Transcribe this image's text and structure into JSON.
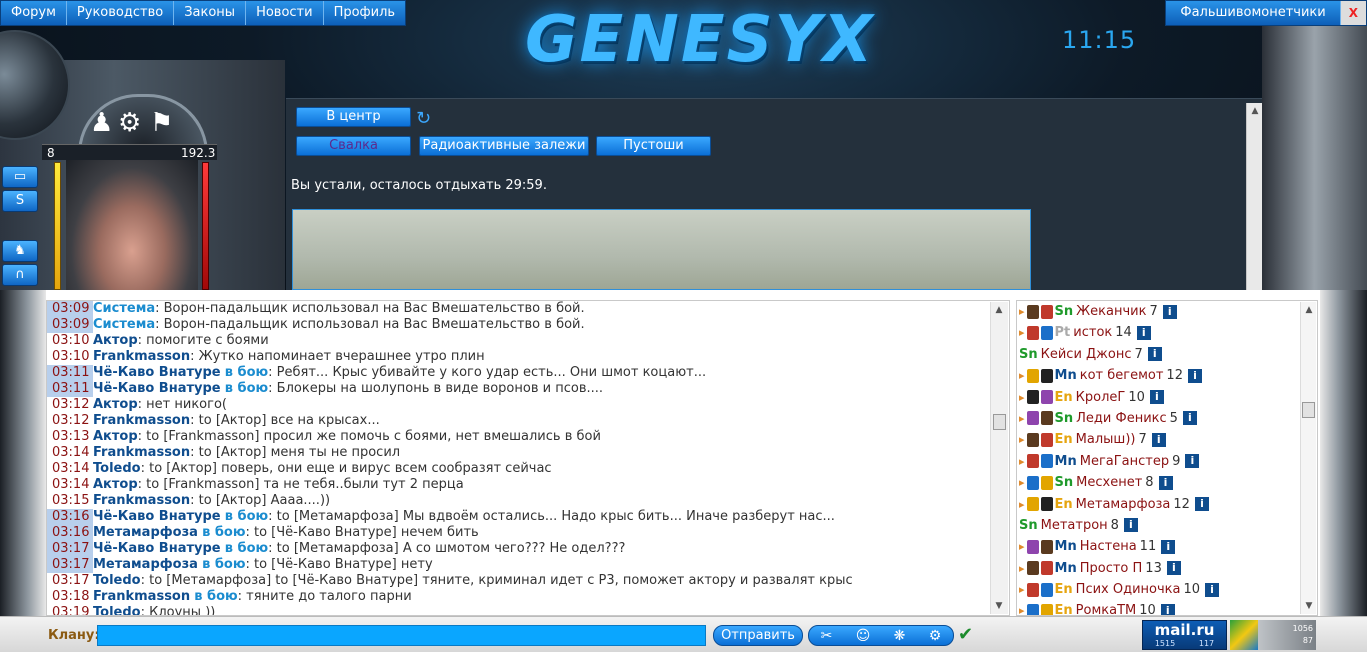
{
  "nav": {
    "items": [
      "Форум",
      "Руководство",
      "Законы",
      "Новости",
      "Профиль"
    ],
    "right_item": "Фальшивомонетчики",
    "close": "X"
  },
  "logo_text": "GENESYX",
  "clock": "11:15",
  "hud": {
    "hp_left": "8",
    "hp_right": "192.3"
  },
  "location": {
    "center_btn": "В центр",
    "exits": [
      "Свалка",
      "Радиоактивные залежи",
      "Пустоши"
    ],
    "rest_message": "Вы устали, осталось отдыхать 29:59."
  },
  "chat": {
    "lines": [
      {
        "time": "03:09",
        "hl": true,
        "nick": "Система",
        "sys": true,
        "battle": "",
        "text": ": Ворон-падальщик использовал на Вас Вмешательство в бой."
      },
      {
        "time": "03:09",
        "hl": true,
        "nick": "Система",
        "sys": true,
        "battle": "",
        "text": ": Ворон-падальщик использовал на Вас Вмешательство в бой."
      },
      {
        "time": "03:10",
        "hl": false,
        "nick": "Актор",
        "sys": false,
        "battle": "",
        "text": ": помогите с боями"
      },
      {
        "time": "03:10",
        "hl": false,
        "nick": "Frankmasson",
        "sys": false,
        "battle": "",
        "text": ": Жутко напоминает вчерашнее утро плин"
      },
      {
        "time": "03:11",
        "hl": true,
        "nick": "Чё-Каво Внатуре",
        "sys": false,
        "battle": "в бою",
        "text": ": Ребят... Крыс убивайте у кого удар есть... Они шмот коцают..."
      },
      {
        "time": "03:11",
        "hl": true,
        "nick": "Чё-Каво Внатуре",
        "sys": false,
        "battle": "в бою",
        "text": ": Блокеры на шолупонь в виде воронов и псов...."
      },
      {
        "time": "03:12",
        "hl": false,
        "nick": "Актор",
        "sys": false,
        "battle": "",
        "text": ": нет никого("
      },
      {
        "time": "03:12",
        "hl": false,
        "nick": "Frankmasson",
        "sys": false,
        "battle": "",
        "text": ": to [Актор] все на крысах..."
      },
      {
        "time": "03:13",
        "hl": false,
        "nick": "Актор",
        "sys": false,
        "battle": "",
        "text": ": to [Frankmasson] просил же помочь с боями, нет вмешались в бой"
      },
      {
        "time": "03:14",
        "hl": false,
        "nick": "Frankmasson",
        "sys": false,
        "battle": "",
        "text": ": to [Актор] меня ты не просил"
      },
      {
        "time": "03:14",
        "hl": false,
        "nick": "Toledo",
        "sys": false,
        "battle": "",
        "text": ": to [Актор] поверь, они еще и вирус всем сообразят сейчас"
      },
      {
        "time": "03:14",
        "hl": false,
        "nick": "Актор",
        "sys": false,
        "battle": "",
        "text": ": to [Frankmasson] та не тебя..были тут 2 перца"
      },
      {
        "time": "03:15",
        "hl": false,
        "nick": "Frankmasson",
        "sys": false,
        "battle": "",
        "text": ": to [Актор] Аааа....))"
      },
      {
        "time": "03:16",
        "hl": true,
        "nick": "Чё-Каво Внатуре",
        "sys": false,
        "battle": "в бою",
        "text": ": to [Метамарфоза] Мы вдвоём остались... Надо крыс бить... Иначе разберут нас..."
      },
      {
        "time": "03:16",
        "hl": true,
        "nick": "Метамарфоза",
        "sys": false,
        "battle": "в бою",
        "text": ": to [Чё-Каво Внатуре] нечем бить"
      },
      {
        "time": "03:17",
        "hl": true,
        "nick": "Чё-Каво Внатуре",
        "sys": false,
        "battle": "в бою",
        "text": ": to [Метамарфоза] А со шмотом чего??? Не одел???"
      },
      {
        "time": "03:17",
        "hl": true,
        "nick": "Метамарфоза",
        "sys": false,
        "battle": "в бою",
        "text": ": to [Чё-Каво Внатуре] нету"
      },
      {
        "time": "03:17",
        "hl": false,
        "nick": "Toledo",
        "sys": false,
        "battle": "",
        "text": ": to [Метамарфоза] to [Чё-Каво Внатуре] тяните, криминал идет с Р3, поможет актору и развалят крыс"
      },
      {
        "time": "03:18",
        "hl": false,
        "nick": "Frankmasson",
        "sys": false,
        "battle": "в бою",
        "text": ": тяните до талого парни"
      },
      {
        "time": "03:19",
        "hl": false,
        "nick": "Toledo",
        "sys": false,
        "battle": "",
        "text": ": Клоуны ))"
      }
    ]
  },
  "users": [
    {
      "clan": "Sn",
      "name": "Жеканчик",
      "level": "7",
      "arrow": true
    },
    {
      "clan": "Pt",
      "name": "исток",
      "level": "14",
      "arrow": true
    },
    {
      "clan": "Sn",
      "name": "Кейси Джонс",
      "level": "7",
      "arrow": false
    },
    {
      "clan": "Mn",
      "name": "кот бегемот",
      "level": "12",
      "arrow": true
    },
    {
      "clan": "En",
      "name": "КролеГ",
      "level": "10",
      "arrow": true
    },
    {
      "clan": "Sn",
      "name": "Леди Феникс",
      "level": "5",
      "arrow": true
    },
    {
      "clan": "En",
      "name": "Малыш))",
      "level": "7",
      "arrow": true
    },
    {
      "clan": "Mn",
      "name": "МегаГанстер",
      "level": "9",
      "arrow": true
    },
    {
      "clan": "Sn",
      "name": "Месхенет",
      "level": "8",
      "arrow": true
    },
    {
      "clan": "En",
      "name": "Метамарфоза",
      "level": "12",
      "arrow": true
    },
    {
      "clan": "Sn",
      "name": "Метатрон",
      "level": "8",
      "arrow": false
    },
    {
      "clan": "Mn",
      "name": "Настена",
      "level": "11",
      "arrow": true
    },
    {
      "clan": "Mn",
      "name": "Просто П",
      "level": "13",
      "arrow": true
    },
    {
      "clan": "En",
      "name": "Псих Одиночка",
      "level": "10",
      "arrow": true
    },
    {
      "clan": "En",
      "name": "РомкаТМ",
      "level": "10",
      "arrow": true
    }
  ],
  "bottom": {
    "clan_label": "Клану:",
    "input_value": "",
    "send_label": "Отправить",
    "mailru_brand": "mail.ru",
    "mailru_count1": "1515",
    "mailru_count2": "117",
    "counter1": "1056",
    "counter2": "87"
  },
  "colors": {
    "accent": "#0aa6ff",
    "nav_bg": "#1a7fd8",
    "time": "#8b1212",
    "nick": "#0f4d8e"
  }
}
